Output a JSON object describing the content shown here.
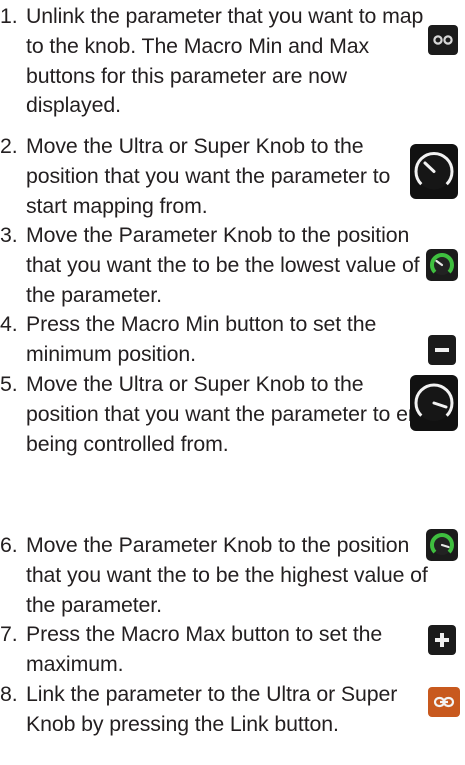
{
  "steps": [
    {
      "number": "1.",
      "text": "Unlink the parameter that you want to map to the knob. The Macro Min and Max buttons for this parameter are now displayed.",
      "icon": "unlinked-chain-icon"
    },
    {
      "number": "2.",
      "text": "Move the Ultra or Super Knob to the position that you want the parameter to start mapping from.",
      "icon": "white-knob-low-icon"
    },
    {
      "number": "3.",
      "text": "Move the Parameter Knob to the position that you want the to be the lowest value of the parameter.",
      "icon": "green-knob-low-icon"
    },
    {
      "number": "4.",
      "text": "Press the Macro Min button to set the minimum position.",
      "icon": "minus-button-icon"
    },
    {
      "number": "5.",
      "text": "Move the Ultra or Super Knob to the position that you want the parameter to end being controlled from.",
      "icon": "white-knob-high-icon"
    },
    {
      "number": "6.",
      "text": "Move the Parameter Knob to the position that you want the to be the highest value of the parameter.",
      "icon": "green-knob-high-icon"
    },
    {
      "number": "7.",
      "text": "Press the Macro Max button to set the maximum.",
      "icon": "plus-button-icon"
    },
    {
      "number": "8.",
      "text": "Link the parameter to the Ultra or Super Knob by pressing the Link button.",
      "icon": "linked-chain-icon"
    }
  ],
  "colors": {
    "text": "#231f20",
    "icon_dark": "#1b1b1b",
    "knob_green": "#3fbf3f",
    "link_orange": "#c8591e"
  }
}
